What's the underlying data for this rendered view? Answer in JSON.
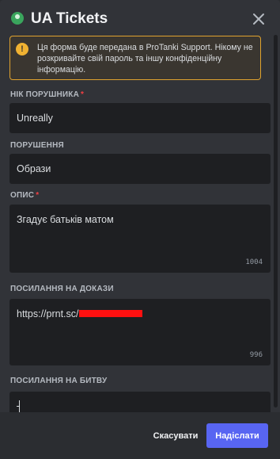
{
  "modal": {
    "title": "UA Tickets",
    "app_icon": "bot-avatar-icon",
    "close_icon": "close-icon"
  },
  "notice": {
    "icon": "warning-icon",
    "icon_glyph": "!",
    "text": "Ця форма буде передана в ProTanki Support. Нікому не розкривайте свій пароль та іншу конфіденційну інформацію."
  },
  "form": {
    "offender": {
      "label": "НІК ПОРУШНИКА",
      "required": "*",
      "value": "Unreally"
    },
    "violation": {
      "label": "ПОРУШЕННЯ",
      "value": "Образи"
    },
    "description": {
      "label": "ОПИС",
      "required": "*",
      "value": "Згадує батьків матом",
      "remaining": "1004"
    },
    "evidence": {
      "label": "ПОСИЛАННЯ НА ДОКАЗИ",
      "value": "https://prnt.sc/",
      "remaining": "996"
    },
    "battle": {
      "label": "ПОСИЛАННЯ НА БИТВУ",
      "value": ""
    }
  },
  "footer": {
    "cancel_label": "Скасувати",
    "submit_label": "Надіслати"
  },
  "colors": {
    "accent": "#5865f2",
    "warning": "#f0b232",
    "required": "#f23f43",
    "redaction": "#ff1010"
  }
}
